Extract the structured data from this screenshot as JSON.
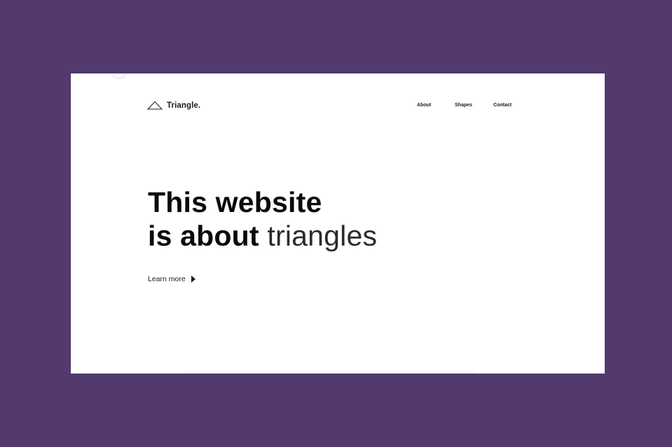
{
  "colors": {
    "backdrop": "#52396e",
    "page": "#ffffff",
    "text": "#0a0a0a"
  },
  "header": {
    "logo": {
      "icon": "triangle-outline-icon",
      "text": "Triangle."
    },
    "nav": [
      {
        "label": "About"
      },
      {
        "label": "Shapes"
      },
      {
        "label": "Contact"
      }
    ]
  },
  "hero": {
    "line1": "This website",
    "line2_bold": "is about",
    "line2_light": "triangles"
  },
  "cta": {
    "label": "Learn more",
    "icon": "play-arrow-icon"
  }
}
